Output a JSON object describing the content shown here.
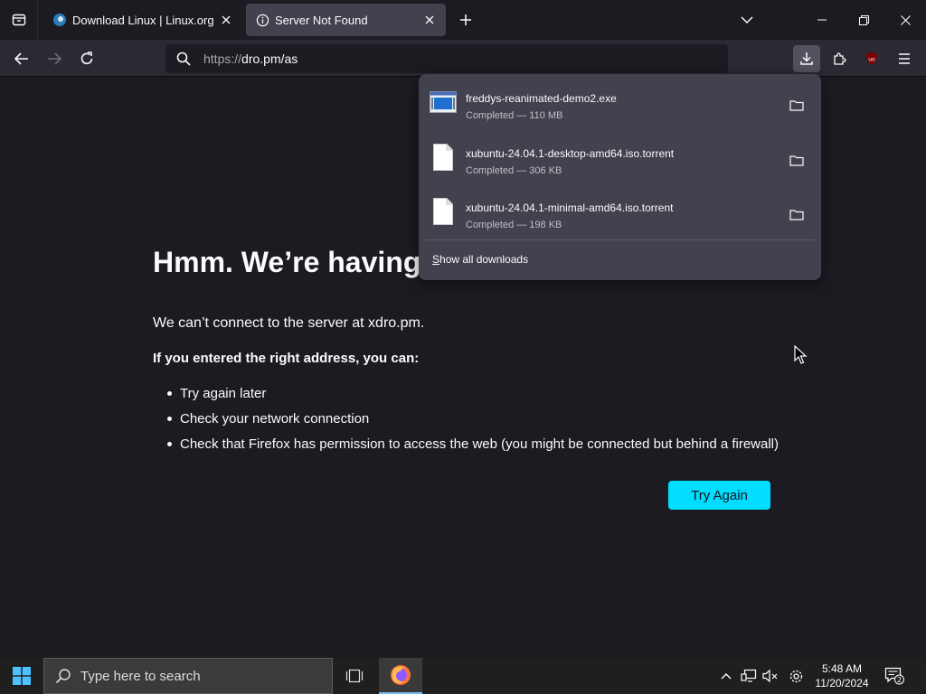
{
  "browser": {
    "tabs": [
      {
        "title": "Download Linux | Linux.org",
        "icon": "linux-org-favicon"
      },
      {
        "title": "Server Not Found",
        "icon": "info-icon"
      }
    ],
    "url_scheme": "https://",
    "url_rest": "dro.pm/as"
  },
  "error": {
    "title_visible": "Hmm. We’re having",
    "description": "We can’t connect to the server at xdro.pm.",
    "suggestions_heading": "If you entered the right address, you can:",
    "suggestions": [
      "Try again later",
      "Check your network connection",
      "Check that Firefox has permission to access the web (you might be connected but behind a firewall)"
    ],
    "try_again_label": "Try Again"
  },
  "downloads": {
    "items": [
      {
        "name": "freddys-reanimated-demo2.exe",
        "status": "Completed — 110 MB",
        "icon": "executable-icon"
      },
      {
        "name": "xubuntu-24.04.1-desktop-amd64.iso.torrent",
        "status": "Completed — 306 KB",
        "icon": "file-icon"
      },
      {
        "name": "xubuntu-24.04.1-minimal-amd64.iso.torrent",
        "status": "Completed — 198 KB",
        "icon": "file-icon"
      }
    ],
    "show_all_prefix": "S",
    "show_all_rest": "how all downloads"
  },
  "taskbar": {
    "search_placeholder": "Type here to search",
    "time": "5:48 AM",
    "date": "11/20/2024",
    "notification_count": "2"
  },
  "colors": {
    "accent": "#00ddff",
    "background": "#1c1b22",
    "toolbar": "#2b2a33",
    "panel": "#42414d"
  }
}
